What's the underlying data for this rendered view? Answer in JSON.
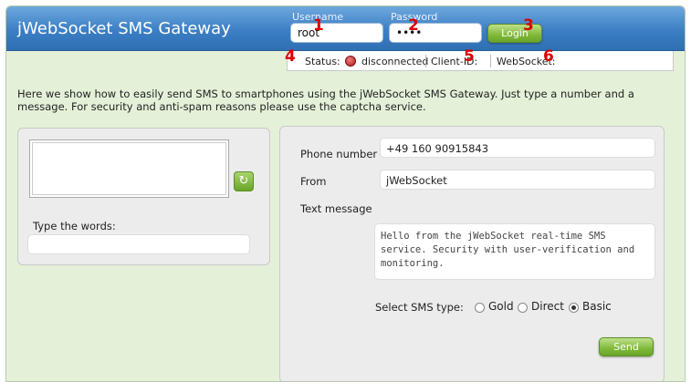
{
  "header": {
    "title": "jWebSocket SMS Gateway",
    "username_label": "Username",
    "username_value": "root",
    "password_label": "Password",
    "password_value": "••••",
    "login_label": "Login"
  },
  "annotations": [
    "1",
    "2",
    "3",
    "4",
    "5",
    "6"
  ],
  "status_bar": {
    "status_label": "Status:",
    "status_value": "disconnected",
    "client_id_label": "Client-ID:",
    "websocket_label": "WebSocket:",
    "status_color": "#c0392b"
  },
  "intro": "Here we show how to easily send SMS to smartphones using the jWebSocket SMS Gateway. Just type a number and a message. For security and anti-spam reasons please use the captcha service.",
  "captcha": {
    "label": "Type the words:",
    "input_value": "",
    "reload_icon": "↻"
  },
  "sms_form": {
    "phone_label": "Phone number",
    "phone_value": "+49 160 90915843",
    "from_label": "From",
    "from_value": "jWebSocket",
    "message_label": "Text message",
    "message_value": "Hello from the jWebSocket real-time SMS service. Security with user-verification and monitoring.",
    "sms_type_label": "Select SMS type:",
    "options": [
      {
        "label": "Gold",
        "checked": false
      },
      {
        "label": "Direct",
        "checked": false
      },
      {
        "label": "Basic",
        "checked": true
      }
    ],
    "send_label": "Send"
  },
  "colors": {
    "header": "#3c7fc4",
    "background": "#e4f1d8",
    "button_green": "#7fb93a",
    "annotation": "#dd0000"
  }
}
